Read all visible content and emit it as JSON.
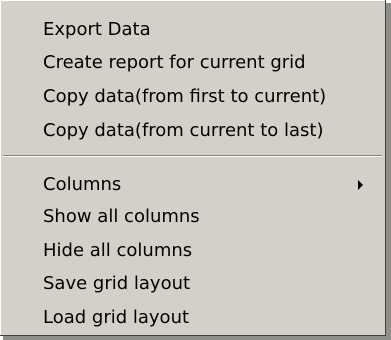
{
  "menu": {
    "group1": [
      {
        "label": "Export Data"
      },
      {
        "label": "Create report for current grid"
      },
      {
        "label": "Copy data(from first to current)"
      },
      {
        "label": "Copy data(from current to last)"
      }
    ],
    "group2": [
      {
        "label": "Columns",
        "submenu": true
      },
      {
        "label": "Show all columns"
      },
      {
        "label": "Hide all columns"
      },
      {
        "label": "Save grid layout"
      },
      {
        "label": "Load grid layout"
      }
    ]
  },
  "colors": {
    "menu_background": "#d4d0c8",
    "separator_dark": "#808080",
    "separator_light": "#ffffff",
    "shadow": "#8f8d88",
    "text": "#000000"
  }
}
